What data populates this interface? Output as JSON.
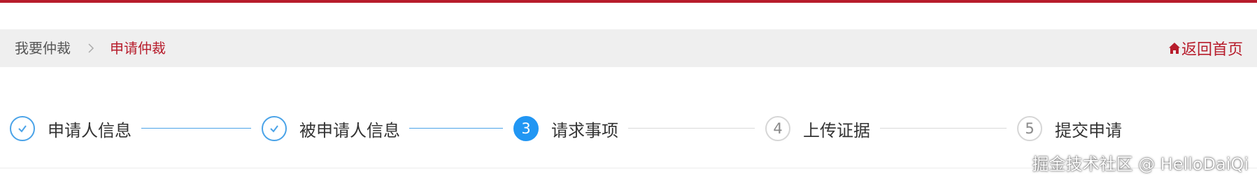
{
  "colors": {
    "brand": "#b71c2b",
    "step_done": "#4aa3e8",
    "step_active": "#2196f3",
    "step_pending": "#d6d6d6"
  },
  "breadcrumb": {
    "root": "我要仲裁",
    "current": "申请仲裁"
  },
  "header": {
    "home_icon": "home-icon",
    "home_label": "返回首页"
  },
  "steps": [
    {
      "status": "done",
      "icon": "check-icon",
      "label": "申请人信息"
    },
    {
      "status": "done",
      "icon": "check-icon",
      "label": "被申请人信息"
    },
    {
      "status": "active",
      "number": "3",
      "label": "请求事项"
    },
    {
      "status": "pending",
      "number": "4",
      "label": "上传证据"
    },
    {
      "status": "pending",
      "number": "5",
      "label": "提交申请"
    }
  ],
  "watermark": "掘金技术社区 @ HelloDaiQi"
}
